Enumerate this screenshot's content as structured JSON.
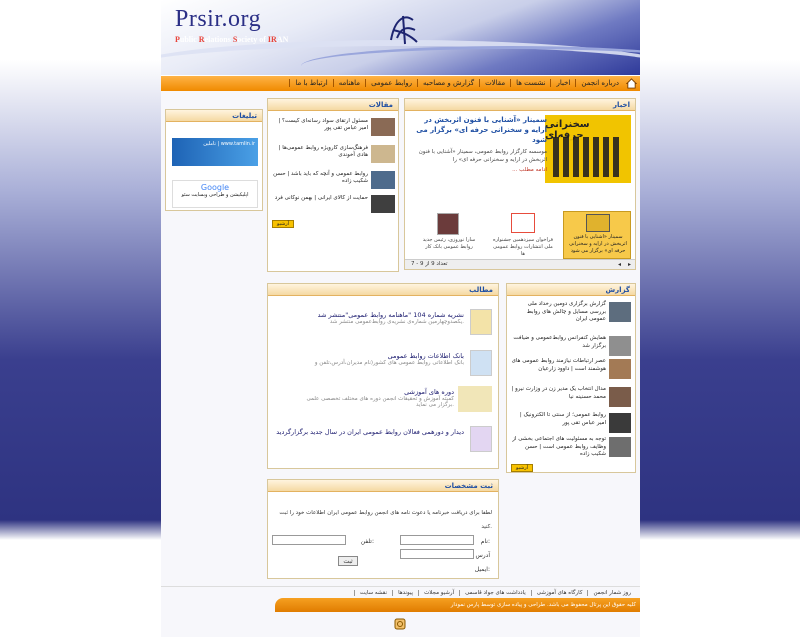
{
  "header": {
    "logo": "Prsir.org",
    "subtitle_parts": [
      "P",
      "ublic ",
      "R",
      "elations ",
      "S",
      "ociety of ",
      "IR",
      "AN"
    ]
  },
  "nav": {
    "items": [
      "درباره انجمن",
      "اخبار",
      "نشست ها",
      "مقالات",
      "گزارش و مصاحبه",
      "روابط عمومی",
      "ماهنامه",
      "ارتباط با ما"
    ]
  },
  "news": {
    "title": "اخبار",
    "headline": "سمینار «آشنایی با فنون اثربخش در ارایه و سخنرانی حرفه ای» برگزار می شود",
    "image_caption": "سخنرانی حرفه‌ای",
    "body": "موسسه کارگزار روابط عمومی، سمینار «آشنایی با فنون اثربخش در ارایه و سخنرانی حرفه ای» را",
    "more": "... ادامه مطلب",
    "cards": [
      {
        "title": "سمینار «آشنایی با فنون اثربخش در ارایه و سخنرانی حرفه ای» برگزار می شود",
        "img": "سخنرانی حرفه‌ای"
      },
      {
        "title": "فراخوان سیزدهمین جشنواره ملی انتشارات روابط عمومی ها"
      },
      {
        "title": "سارا نوروزی، رئیس جدید روابط عمومی بانک کار"
      }
    ],
    "pager": "تعداد 9 از 9 - 7"
  },
  "articles": {
    "title": "مقالات",
    "items": [
      "مسئول ارتقای سواد رسانه‌ای کیست؟ | امیر عباس تقی پور",
      "فرهنگ‌سازی کارویژه روابط عمومی‌ها | هادی آخوندی",
      "روابط عمومی و آنچه که باید باشد | حسن شکیب زاده",
      "حمایت از کالای ایرانی | بهمن نوکانی فرد"
    ],
    "archive": "آرشیو"
  },
  "ads": {
    "title": "تبلیغات",
    "ad1": "تاملین | www.tamlin.ir",
    "ad2_brand": "Google",
    "ad2": "اپلیکیشن و طراحی وبسایت سئو"
  },
  "materials": {
    "title": "مطالب",
    "items": [
      {
        "title": "نشریه شماره 104 \"ماهنامه روابط عمومی\"منتشر شد",
        "sub": "یکصدوچهارمین شماره‌ی نشریه‌ی روابط‌عمومی منتشر شد."
      },
      {
        "title": "بانک اطلاعات روابط عمومی",
        "sub": "بانک اطلاعاتی روابط عمومی های کشور(نام مدیران،آدرس،تلفن و"
      },
      {
        "title": "دوره های آموزشی",
        "sub": "کمیته آموزش و تحقیقات انجمن دوره های مختلف تخصصی علمی برگزار می نماید."
      },
      {
        "title": "دیدار و دورهمی فعالان روابط عمومی ایران در سال جدید برگزارگردید",
        "sub": ""
      }
    ]
  },
  "reports": {
    "title": "گزارش",
    "items": [
      "گزارش برگزاری دومین رخداد ملی بررسی مسایل و چالش های روابط عمومی ایران",
      "همایش کنفرانس روابط‌عمومی و ضیافت برگزار شد",
      "عصر ارتباطات نیازمند روابط عمومی های هوشمند است | داوود زارعیان",
      "مدال انتخاب یک مدیر زن در وزارت نیرو | محمد حسنینه نیا",
      "روابط عمومی؛ از سنتی تا الکترونیک | امیر عباس تقی پور",
      "توجه به مسئولیت های اجتماعی بخشی از وظایف روابط عمومی است | حسن شکیب زاده"
    ],
    "archive": "آرشیو"
  },
  "register": {
    "title": "ثبت مشخصات",
    "intro": "لطفا برای دریافت خبرنامه یا دعوت نامه های انجمن روابط عمومی ایران اطلاعات خود را ثبت کنید.",
    "name": "نام:",
    "phone": "تلفن:",
    "address": "آدرس",
    "email": "ایمیل:",
    "submit": "ثبت"
  },
  "footer": {
    "links": [
      "روز شمار انجمن",
      "کارگاه های آموزشی",
      "یادداشت های جواد قاسمی",
      "آرشیو مجلات",
      "پیوندها",
      "نقشه سایت"
    ],
    "copyright": "کلیه حقوق این پرتال محفوظ می باشد. طراحی و پیاده سازی توسط پارس نمودار"
  }
}
